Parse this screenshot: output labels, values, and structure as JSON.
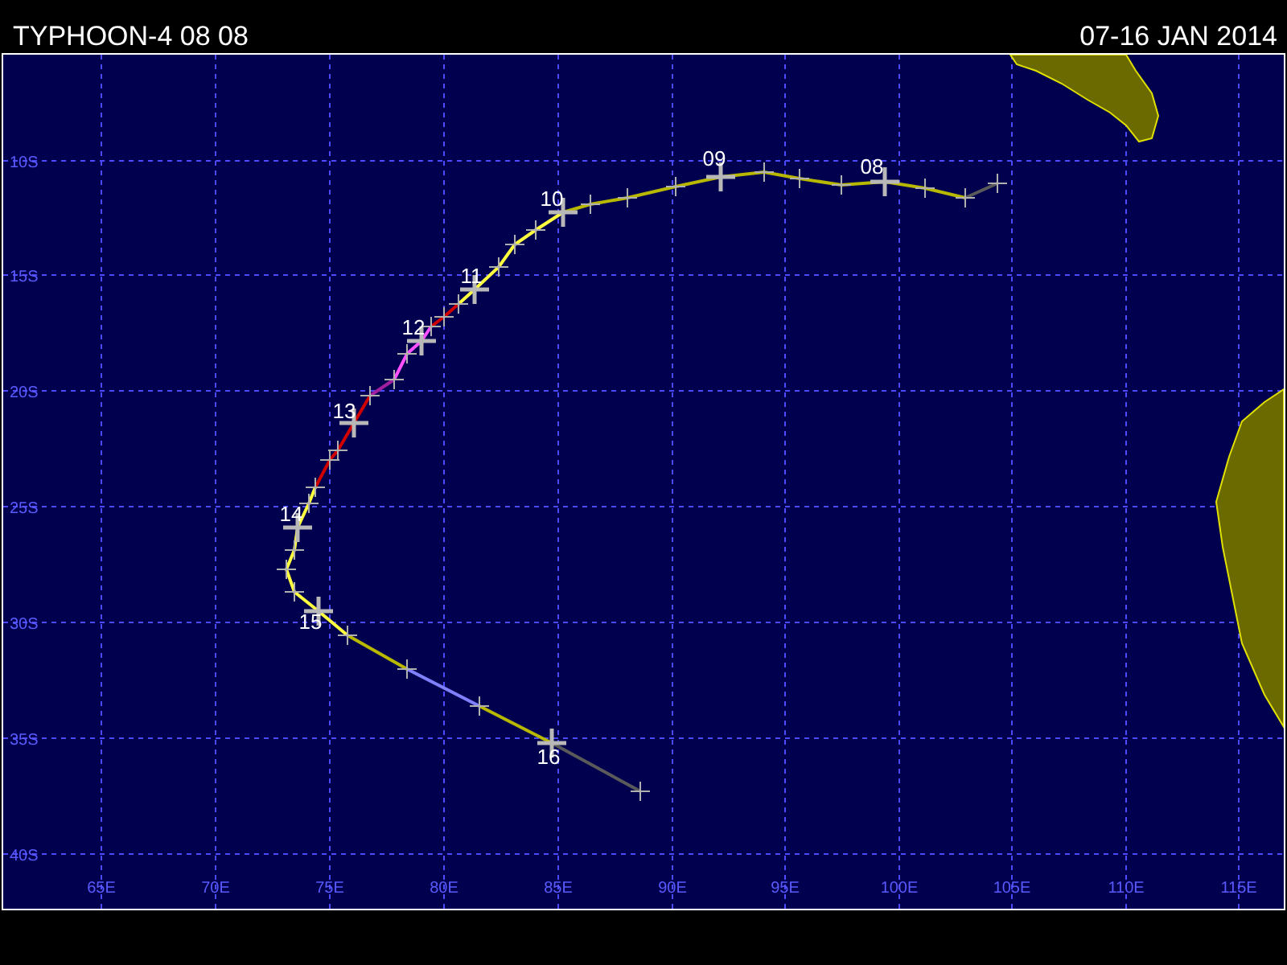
{
  "header": {
    "title": "TYPHOON-4 08 08",
    "period": "07-16 JAN 2014"
  },
  "map": {
    "latitude_labels": [
      "10S",
      "15S",
      "20S",
      "25S",
      "30S",
      "35S",
      "40S"
    ],
    "longitude_labels": [
      "65E",
      "70E",
      "75E",
      "80E",
      "85E",
      "90E",
      "95E",
      "100E",
      "105E",
      "110E",
      "115E"
    ],
    "day_labels": [
      "08",
      "09",
      "10",
      "11",
      "12",
      "13",
      "14",
      "15",
      "16"
    ]
  }
}
